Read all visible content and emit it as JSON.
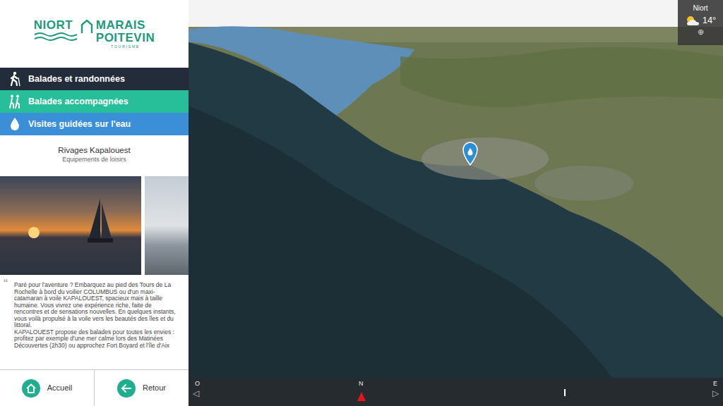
{
  "brand": {
    "left": "NIORT",
    "right_top": "MARAIS",
    "right_bottom": "POITEVIN",
    "tagline": "TOURISME"
  },
  "menu": [
    {
      "label": "Balades et randonnées",
      "kind": "hiking",
      "color": "#222c3a"
    },
    {
      "label": "Balades accompagnées",
      "kind": "group",
      "color": "#27bf99"
    },
    {
      "label": "Visites guidées sur l'eau",
      "kind": "water",
      "color": "#3a8fd8"
    }
  ],
  "place": {
    "title": "Rivages Kapalouest",
    "category": "Equipements de loisirs"
  },
  "description": {
    "quote_mark": "“",
    "paragraphs": [
      "Paré pour l'aventure ? Embarquez au pied des Tours de La Rochelle à bord du voilier COLUMBUS ou d'un maxi-catamaran à voile KAPALOUEST, spacieux mais à taille humaine. Vous vivrez une expérience riche, faite de rencontres et de sensations nouvelles. En quelques instants, vous voilà propulsé à la voile vers les beautés des îles et du littoral.",
      "KAPALOUEST propose des balades pour toutes les envies : profitez par exemple d'une mer calme lors des Matinées Découvertes (2h30) ou approchez Fort Boyard et l'île d'Aix"
    ]
  },
  "nav_buttons": [
    {
      "label": "Accueil",
      "kind": "home"
    },
    {
      "label": "Retour",
      "kind": "back"
    }
  ],
  "weather": {
    "city": "Niort",
    "temperature": "14°",
    "more": "⊕"
  },
  "map": {
    "pins": [
      {
        "kind": "water"
      }
    ]
  },
  "compass": {
    "left_arrow": "◁",
    "right_arrow": "▷",
    "labels": [
      {
        "text": "O",
        "selected": false
      },
      {
        "text": "N",
        "selected": true
      },
      {
        "text": "E",
        "selected": false
      }
    ]
  }
}
